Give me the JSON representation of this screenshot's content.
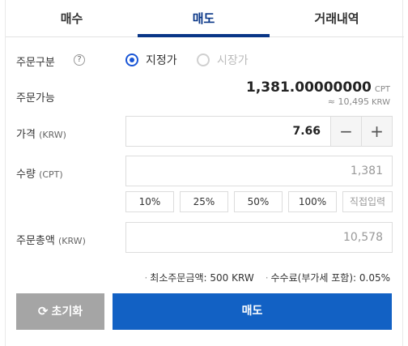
{
  "tabs": [
    {
      "label": "매수"
    },
    {
      "label": "매도"
    },
    {
      "label": "거래내역"
    }
  ],
  "order_type": {
    "label": "주문구분",
    "help_glyph": "?",
    "options": [
      {
        "label": "지정가",
        "selected": true
      },
      {
        "label": "시장가",
        "selected": false
      }
    ]
  },
  "available": {
    "label": "주문가능",
    "amount": "1,381.00000000",
    "currency": "CPT",
    "krw_approx": "≈ 10,495",
    "krw_currency": "KRW"
  },
  "price": {
    "label": "가격",
    "unit": "(KRW)",
    "value": "7.66",
    "minus": "−",
    "plus": "+"
  },
  "quantity": {
    "label": "수량",
    "unit": "(CPT)",
    "value": "1,381",
    "percent_buttons": [
      "10%",
      "25%",
      "50%",
      "100%"
    ],
    "direct_input": "직접입력"
  },
  "total": {
    "label": "주문총액",
    "unit": "(KRW)",
    "value": "10,578"
  },
  "notes": {
    "bullet": "·",
    "min_order": "최소주문금액: 500 KRW",
    "fee": "수수료(부가세 포함): 0.05%"
  },
  "buttons": {
    "reset_icon": "⟳",
    "reset": "초기화",
    "sell": "매도"
  },
  "colors": {
    "active_tab": "#093687",
    "sell_button": "#1261c4",
    "reset_button": "#a5a5a5",
    "radio": "#1a56d6"
  }
}
